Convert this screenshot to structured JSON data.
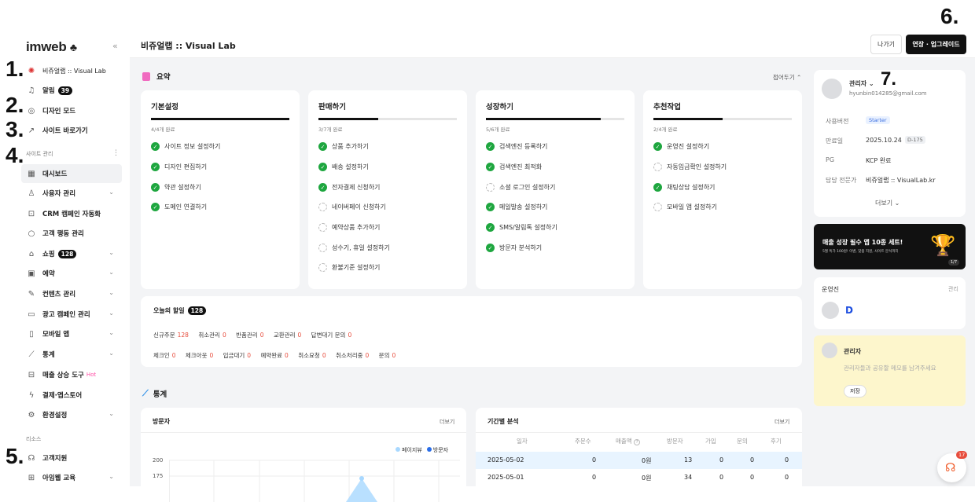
{
  "markers": [
    "1.",
    "2.",
    "3.",
    "4.",
    "5.",
    "6.",
    "7."
  ],
  "sidebar": {
    "logo": "imweb",
    "site_name": "비쥬얼랩 :: Visual Lab",
    "alarm_label": "알림",
    "alarm_count": "39",
    "design_mode": "디자인 모드",
    "shortcut": "사이트 바로가기",
    "section_manage": "사이트 관리",
    "items": [
      {
        "label": "대시보드"
      },
      {
        "label": "사용자 관리"
      },
      {
        "label": "CRM 캠페인 자동화"
      },
      {
        "label": "고객 행동 관리"
      },
      {
        "label": "쇼핑",
        "badge": "128"
      },
      {
        "label": "예약"
      },
      {
        "label": "컨텐츠 관리"
      },
      {
        "label": "광고 캠페인 관리"
      },
      {
        "label": "모바일 앱"
      },
      {
        "label": "통계"
      },
      {
        "label": "매출 상승 도구",
        "hot": "Hot"
      },
      {
        "label": "결제·앱스토어"
      },
      {
        "label": "환경설정"
      }
    ],
    "section_resource": "리소스",
    "support": "고객지원",
    "edu": "아임웹 교육"
  },
  "topbar": {
    "title": "비쥬얼랩 :: Visual Lab",
    "exit": "나가기",
    "upgrade": "연장 · 업그레이드"
  },
  "summary": {
    "title": "요약",
    "fold": "접어두기",
    "cards": [
      {
        "title": "기본설정",
        "count": "4/4개 완료",
        "progress": 1.0,
        "tasks": [
          {
            "t": "사이트 정보 설정하기",
            "done": true
          },
          {
            "t": "디자인 편집하기",
            "done": true
          },
          {
            "t": "약관 설정하기",
            "done": true
          },
          {
            "t": "도메인 연결하기",
            "done": true
          }
        ]
      },
      {
        "title": "판매하기",
        "count": "3/7개 완료",
        "progress": 0.43,
        "tasks": [
          {
            "t": "상품 추가하기",
            "done": true
          },
          {
            "t": "배송 설정하기",
            "done": true
          },
          {
            "t": "전자결제 신청하기",
            "done": true
          },
          {
            "t": "네이버페이 신청하기",
            "done": false
          },
          {
            "t": "예약상품 추가하기",
            "done": false
          },
          {
            "t": "성수기, 휴일 설정하기",
            "done": false
          },
          {
            "t": "환불기준 설정하기",
            "done": false
          }
        ]
      },
      {
        "title": "성장하기",
        "count": "5/6개 완료",
        "progress": 0.83,
        "tasks": [
          {
            "t": "검색엔진 등록하기",
            "done": true
          },
          {
            "t": "검색엔진 최적화",
            "done": true
          },
          {
            "t": "소셜 로그인 설정하기",
            "done": false
          },
          {
            "t": "메일발송 설정하기",
            "done": true
          },
          {
            "t": "SMS/알림톡 설정하기",
            "done": true
          },
          {
            "t": "방문자 분석하기",
            "done": true
          }
        ]
      },
      {
        "title": "추천작업",
        "count": "2/4개 완료",
        "progress": 0.5,
        "tasks": [
          {
            "t": "운영진 설정하기",
            "done": true
          },
          {
            "t": "자동입금확인 설정하기",
            "done": false
          },
          {
            "t": "채팅상담 설정하기",
            "done": true
          },
          {
            "t": "모바일 앱 설정하기",
            "done": false
          }
        ]
      }
    ]
  },
  "todo": {
    "title": "오늘의 할일",
    "count": "128",
    "row1": [
      {
        "l": "신규주문",
        "v": "128"
      },
      {
        "l": "취소관리",
        "v": "0"
      },
      {
        "l": "반품관리",
        "v": "0"
      },
      {
        "l": "교환관리",
        "v": "0"
      },
      {
        "l": "답변대기 문의",
        "v": "0"
      }
    ],
    "row2": [
      {
        "l": "체크인",
        "v": "0"
      },
      {
        "l": "체크아웃",
        "v": "0"
      },
      {
        "l": "입금대기",
        "v": "0"
      },
      {
        "l": "예약완료",
        "v": "0"
      },
      {
        "l": "취소요청",
        "v": "0"
      },
      {
        "l": "취소처리중",
        "v": "0"
      },
      {
        "l": "문의",
        "v": "0"
      }
    ]
  },
  "stats": {
    "title": "통계",
    "visitors": {
      "title": "방문자",
      "more": "더보기",
      "legend": [
        "페이지뷰",
        "방문자"
      ],
      "yticks": [
        "200",
        "175"
      ]
    },
    "period": {
      "title": "기간별 분석",
      "more": "더보기",
      "headers": [
        "일자",
        "주문수",
        "매출액",
        "방문자",
        "가입",
        "문의",
        "후기"
      ],
      "rows": [
        [
          "2025-05-02",
          "0",
          "0원",
          "13",
          "0",
          "0",
          "0"
        ],
        [
          "2025-05-01",
          "0",
          "0원",
          "34",
          "0",
          "0",
          "0"
        ]
      ]
    }
  },
  "account": {
    "role": "관리자",
    "email": "hyunbin014285@gmail.com",
    "version_label": "사용버전",
    "version": "Starter",
    "expiry_label": "만료일",
    "expiry": "2025.10.24",
    "dday": "D-175",
    "pg_label": "PG",
    "pg": "KCP 완료",
    "expert_label": "담당 전문가",
    "expert": "비쥬얼랩 :: VisualLab.kr",
    "more": "더보기"
  },
  "banner": {
    "title": "매출 성장 필수 앱 10종 세트!",
    "sub": "5월 특가 100원! 이벤, 맞춤 지원, 사이트 분석까지",
    "page": "1/7"
  },
  "staff": {
    "title": "운영진",
    "manage": "관리"
  },
  "memo": {
    "title": "관리자",
    "placeholder": "관리자들과 공유할 메모를 남겨주세요",
    "save": "저장"
  },
  "fab": {
    "count": "17"
  },
  "colors": {
    "accent_red": "#e74c3c",
    "check_green": "#1ea63f",
    "memo_bg": "#fdf6cc",
    "legend_pageview": "#a8d8ff",
    "legend_visitor": "#2a6ee8"
  }
}
